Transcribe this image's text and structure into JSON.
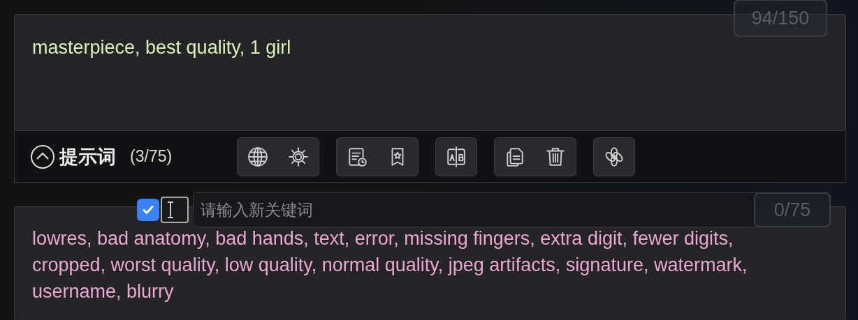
{
  "prompt": {
    "text": "masterpiece, best quality, 1 girl",
    "counter": "94/150"
  },
  "toolbar": {
    "expanded": true,
    "title": "提示词",
    "count": "(3/75)",
    "groups": [
      {
        "buttons": [
          {
            "kind": "globe"
          },
          {
            "kind": "gear"
          }
        ]
      },
      {
        "buttons": [
          {
            "kind": "history"
          },
          {
            "kind": "bookmark"
          }
        ]
      },
      {
        "buttons": [
          {
            "kind": "compare"
          }
        ]
      },
      {
        "buttons": [
          {
            "kind": "copy"
          },
          {
            "kind": "trash"
          }
        ]
      },
      {
        "buttons": [
          {
            "kind": "flower"
          }
        ]
      }
    ]
  },
  "keyword": {
    "checked": true,
    "placeholder": "请输入新关键词",
    "counter": "0/75"
  },
  "negative_prompt": {
    "text": "lowres, bad anatomy, bad hands, text, error, missing fingers, extra digit, fewer digits, cropped, worst quality, low quality, normal quality, jpeg artifacts, signature, watermark, username, blurry"
  }
}
